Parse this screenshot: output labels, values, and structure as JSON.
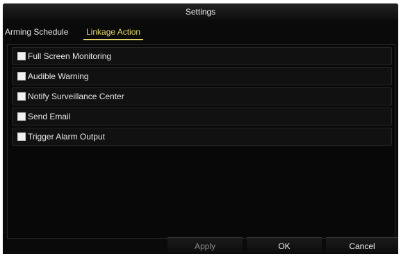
{
  "window": {
    "title": "Settings"
  },
  "tabs": [
    {
      "label": "Arming Schedule",
      "active": false
    },
    {
      "label": "Linkage Action",
      "active": true
    }
  ],
  "options": [
    {
      "label": "Full Screen Monitoring",
      "checked": false
    },
    {
      "label": "Audible Warning",
      "checked": false
    },
    {
      "label": "Notify Surveillance Center",
      "checked": false
    },
    {
      "label": "Send Email",
      "checked": false
    },
    {
      "label": "Trigger Alarm Output",
      "checked": false
    }
  ],
  "buttons": {
    "apply": {
      "label": "Apply",
      "enabled": false
    },
    "ok": {
      "label": "OK",
      "enabled": true
    },
    "cancel": {
      "label": "Cancel",
      "enabled": true
    }
  },
  "colors": {
    "active_tab": "#e3d56a",
    "background": "#0a0a0a"
  }
}
